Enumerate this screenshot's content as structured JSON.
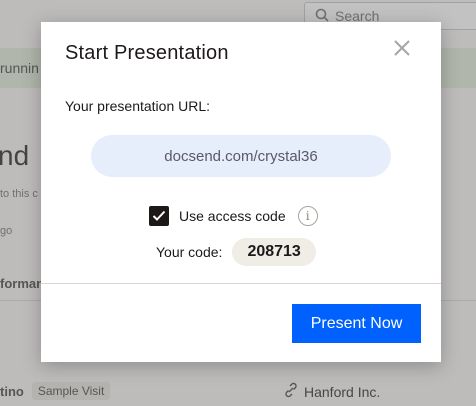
{
  "background": {
    "search_placeholder": "Search",
    "banner_text": "runnin",
    "title_fragment": "nd",
    "subtitle_fragment": "to this c",
    "subtitle2_fragment": "go",
    "section_fragment": "forman",
    "row": {
      "name_fragment": "tino",
      "badge": "Sample Visit",
      "company": "Hanford Inc."
    }
  },
  "modal": {
    "title": "Start Presentation",
    "url_label": "Your presentation URL:",
    "url_value": "docsend.com/crystal36",
    "access_code_label": "Use access code",
    "access_code_checked": true,
    "code_label": "Your code:",
    "code_value": "208713",
    "present_button": "Present Now"
  },
  "colors": {
    "primary": "#0061fe",
    "url_box_bg": "#e6eefc",
    "code_bg": "#f0ece6"
  }
}
